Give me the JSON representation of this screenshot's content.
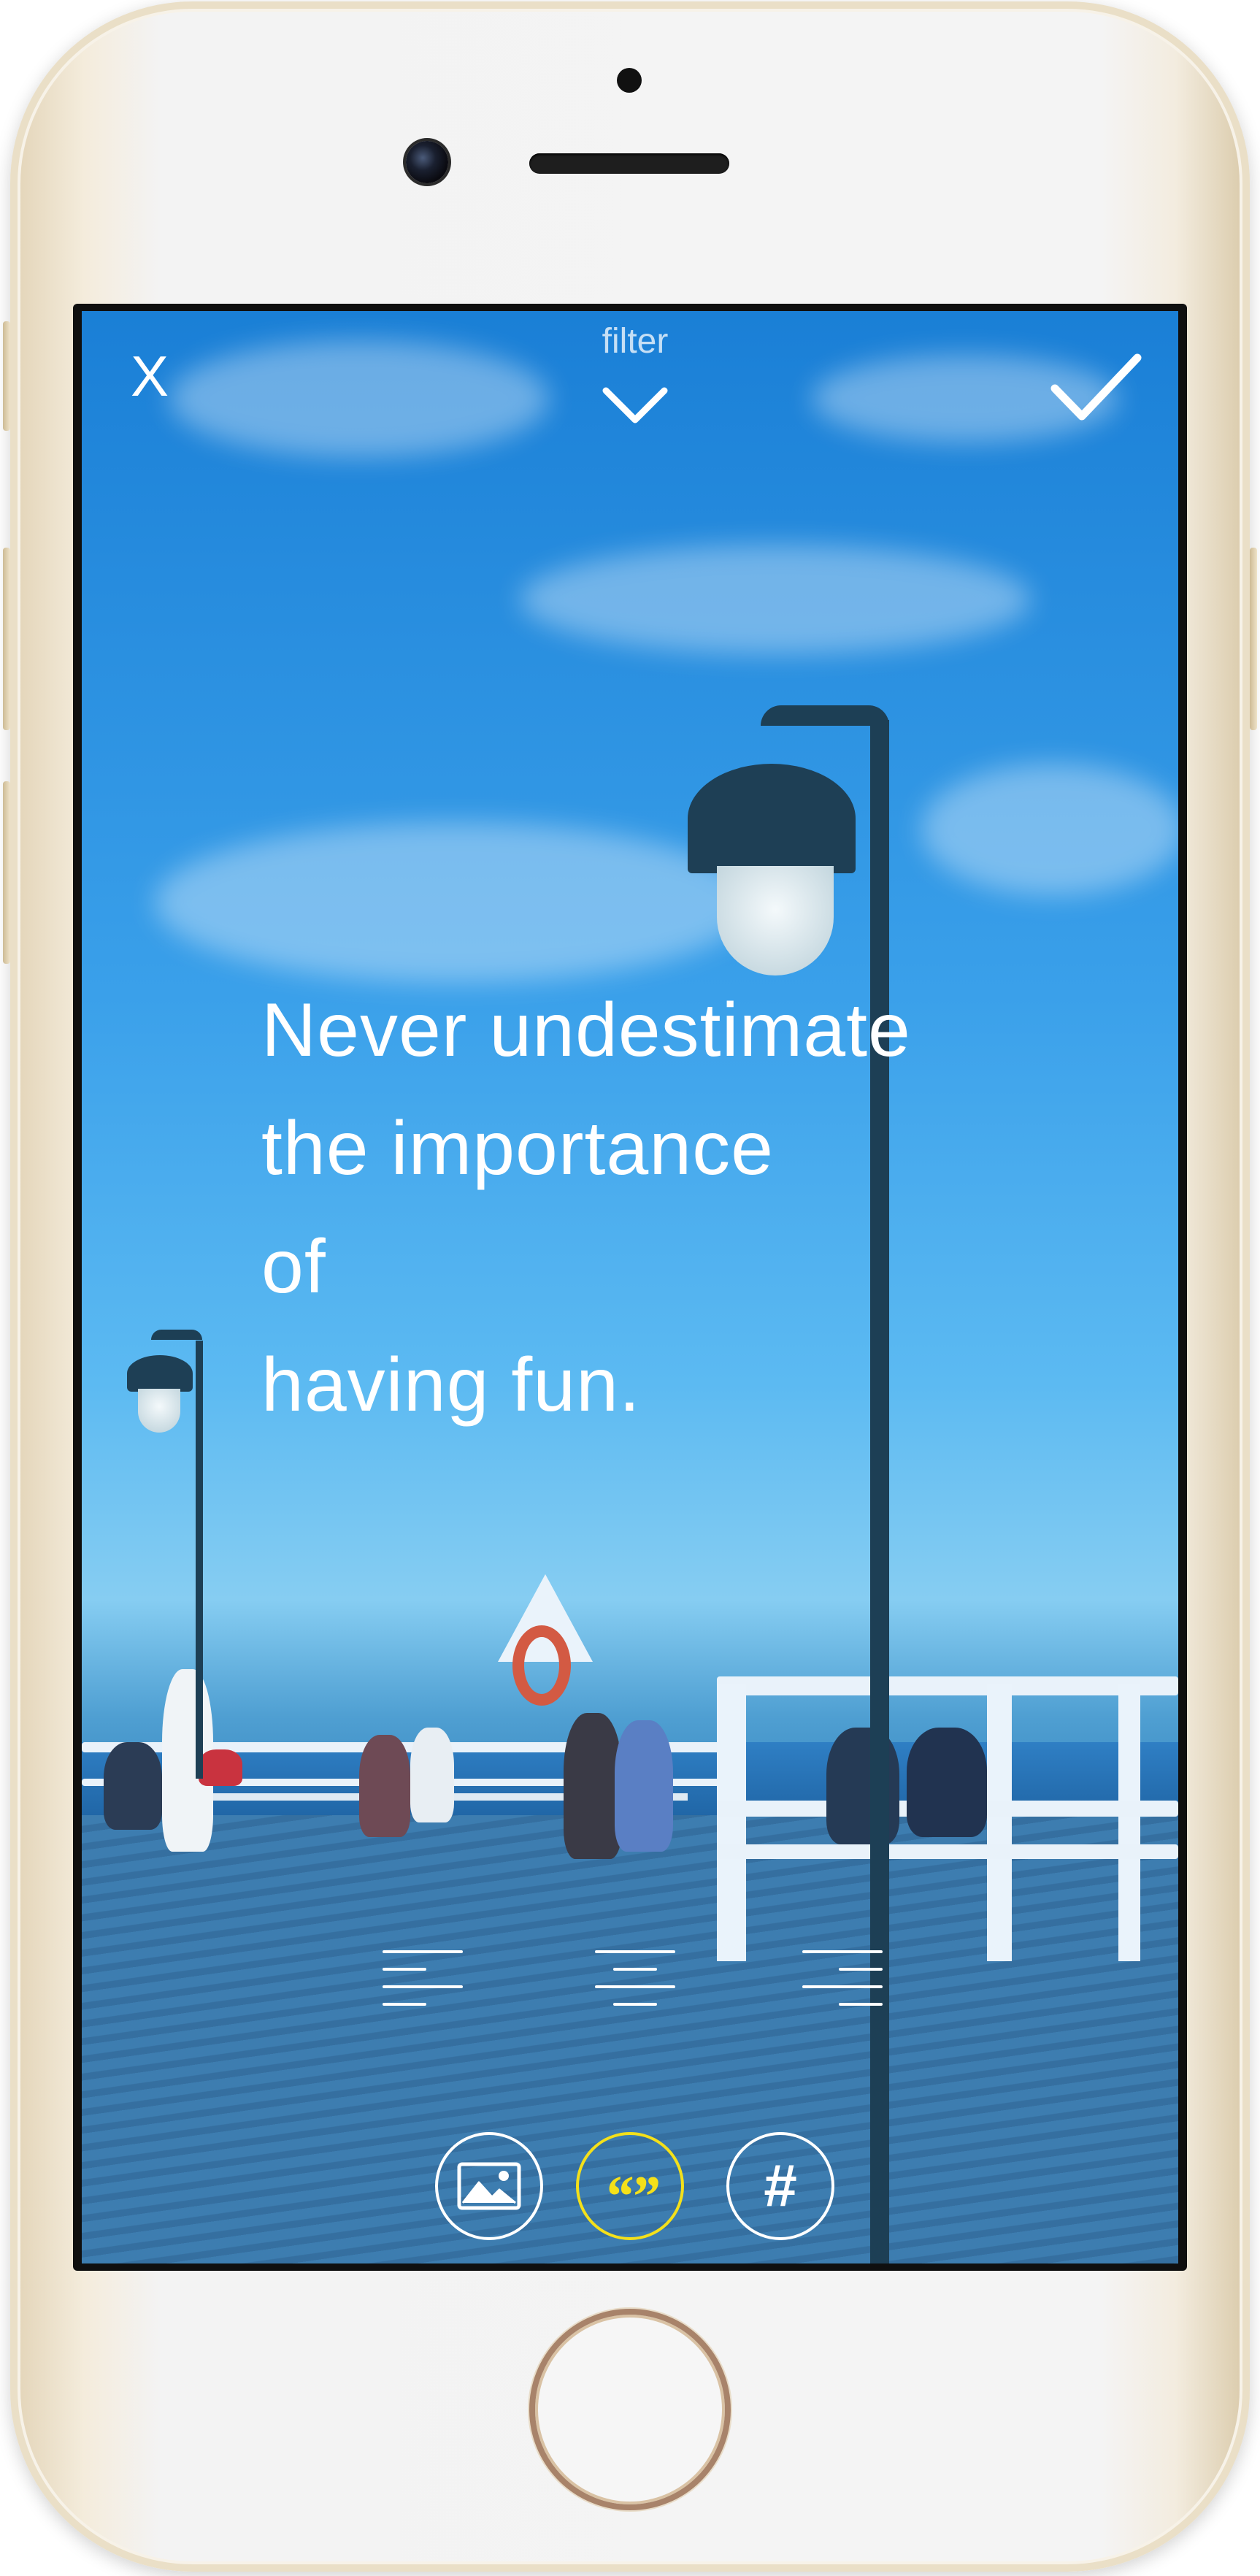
{
  "editor": {
    "close_label": "X",
    "filter_label": "filter",
    "quote_lines": [
      "Never undestimate",
      "the importance",
      "of",
      "having fun."
    ]
  },
  "icons": {
    "close": "close-icon",
    "filter_toggle": "chevron-down-icon",
    "confirm": "checkmark-icon",
    "align_left": "align-left-icon",
    "align_center": "align-center-icon",
    "align_right": "align-right-icon",
    "image_mode": "image-icon",
    "quote_mode": "quote-icon",
    "hashtag_mode": "hashtag-icon"
  },
  "bottom_bar": {
    "quote_glyph": "“”",
    "hashtag_glyph": "#",
    "selected_mode": "quote"
  },
  "colors": {
    "accent": "#f4e01a",
    "overlay_text": "#ffffff",
    "photo_tint": "#3aa0ea"
  }
}
